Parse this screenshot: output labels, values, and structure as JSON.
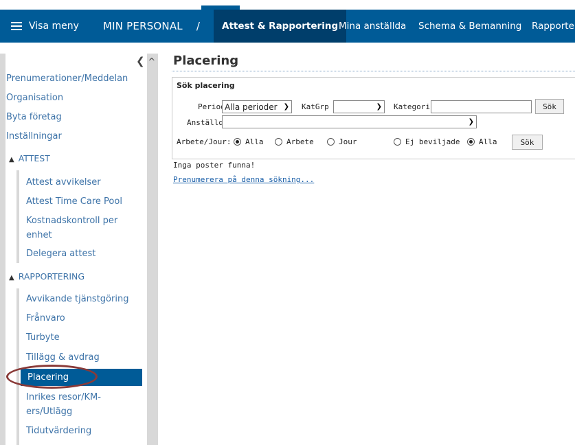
{
  "header": {
    "menu_label": "Visa meny",
    "brand": "MIN PERSONAL",
    "separator": "/",
    "tabs": [
      {
        "label": "Attest & Rapportering",
        "active": true
      },
      {
        "label": "Mina anställda",
        "active": false
      },
      {
        "label": "Schema & Bemanning",
        "active": false
      },
      {
        "label": "Rapporter",
        "active": false
      }
    ]
  },
  "sidebar": {
    "items": [
      {
        "label": "Prenumerationer/Meddelan"
      },
      {
        "label": "Organisation"
      },
      {
        "label": "Byta företag"
      },
      {
        "label": "Inställningar"
      }
    ],
    "attest": {
      "title": "ATTEST",
      "items": [
        "Attest avvikelser",
        "Attest Time Care Pool",
        "Kostnadskontroll per",
        "enhet",
        "Delegera attest"
      ]
    },
    "rapportering": {
      "title": "RAPPORTERING",
      "items": [
        "Avvikande tjänstgöring",
        "Frånvaro",
        "Turbyte",
        "Tillägg & avdrag",
        "Placering",
        "Inrikes resor/KM-",
        "ers/Utlägg",
        "Tidutvärdering"
      ]
    }
  },
  "main": {
    "title": "Placering",
    "panel_title": "Sök placering",
    "period_label": "Period",
    "period_value": "Alla perioder",
    "katgrp_label": "KatGrp",
    "katgrp_value": "",
    "kategori_label": "Kategori",
    "search_button": "Sök",
    "anstalld_label": "Anställd",
    "anstalld_value": "",
    "arbete_label": "Arbete/Jour:",
    "radios1": [
      {
        "label": "Alla",
        "checked": true
      },
      {
        "label": "Arbete",
        "checked": false
      },
      {
        "label": "Jour",
        "checked": false
      }
    ],
    "radios2": [
      {
        "label": "Ej beviljade",
        "checked": false
      },
      {
        "label": "Alla",
        "checked": true
      }
    ],
    "search_button2": "Sök",
    "no_results": "Inga poster funna!",
    "subscribe_link": "Prenumerera på denna sökning..."
  },
  "colors": {
    "nav": "#005b97",
    "nav_active": "#003e6b",
    "link": "#3d73a8",
    "highlight_circle": "#8a3a38"
  }
}
